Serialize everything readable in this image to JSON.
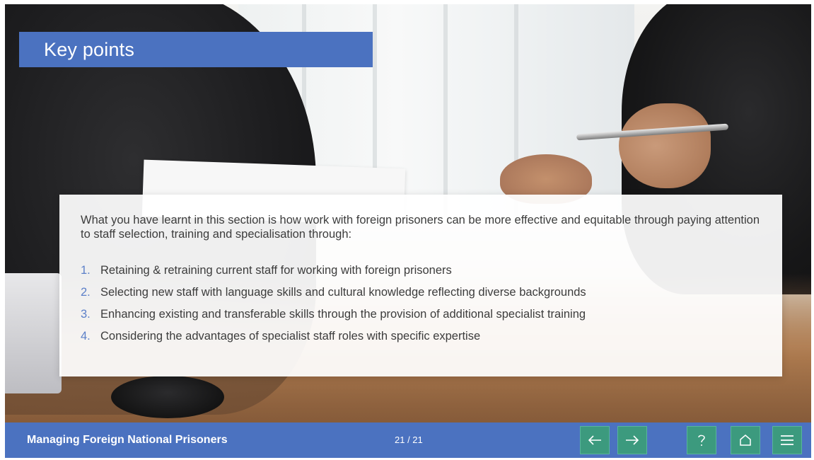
{
  "slide": {
    "title": "Key points",
    "intro": "What you have learnt in this section is how work with foreign prisoners can be more effective and equitable through paying attention to staff selection, training and specialisation through:",
    "points": [
      {
        "num": "1.",
        "text": "Retaining & retraining current staff for working with foreign prisoners"
      },
      {
        "num": "2.",
        "text": "Selecting new staff with language skills and cultural knowledge reflecting diverse backgrounds"
      },
      {
        "num": "3.",
        "text": "Enhancing existing and transferable skills through the provision of additional specialist training"
      },
      {
        "num": "4.",
        "text": "Considering the advantages of specialist staff roles with specific expertise"
      }
    ]
  },
  "footer": {
    "course_title": "Managing Foreign National Prisoners",
    "page_counter": "21 / 21",
    "buttons": [
      {
        "name": "previous",
        "icon": "arrow-left-icon"
      },
      {
        "name": "next",
        "icon": "arrow-right-icon"
      },
      {
        "name": "help",
        "icon": "question-icon"
      },
      {
        "name": "home",
        "icon": "home-icon"
      },
      {
        "name": "menu",
        "icon": "hamburger-menu-icon"
      }
    ]
  },
  "colors": {
    "brand_blue": "#4b72c0",
    "button_green": "#3c9a7e",
    "list_number": "#5b7fc8"
  }
}
